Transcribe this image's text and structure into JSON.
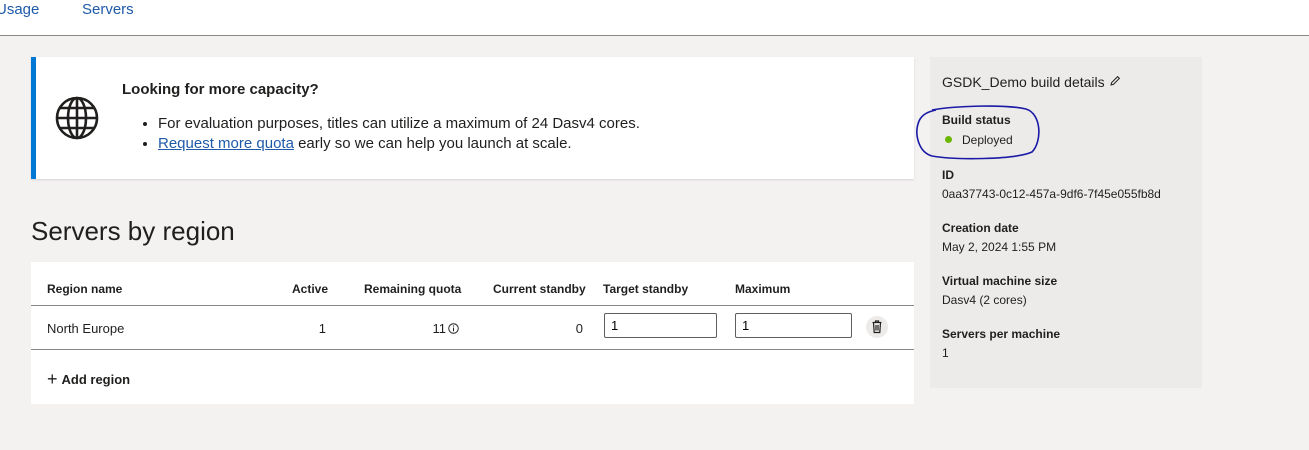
{
  "tabs": {
    "usage": "Usage",
    "servers": "Servers"
  },
  "banner": {
    "title": "Looking for more capacity?",
    "bullet1": "For evaluation purposes, titles can utilize a maximum of 24 Dasv4 cores.",
    "link": "Request more quota",
    "bullet2_rest": " early so we can help you launch at scale.",
    "icon": "globe-icon",
    "accent_color": "#0078d4"
  },
  "section": {
    "title": "Servers by region"
  },
  "table": {
    "headers": {
      "region": "Region name",
      "active": "Active",
      "remaining": "Remaining quota",
      "current_standby": "Current standby",
      "target_standby": "Target standby",
      "maximum": "Maximum"
    },
    "row": {
      "region": "North Europe",
      "active": "1",
      "remaining": "11",
      "current_standby": "0",
      "target_standby": "1",
      "maximum": "1"
    },
    "add_region": "Add region"
  },
  "details": {
    "title": "GSDK_Demo build details",
    "build_status_label": "Build status",
    "build_status_value": "Deployed",
    "status_color": "#6bb700",
    "id_label": "ID",
    "id_value": "0aa37743-0c12-457a-9df6-7f45e055fb8d",
    "creation_label": "Creation date",
    "creation_value": "May 2, 2024 1:55 PM",
    "vm_label": "Virtual machine size",
    "vm_value": "Dasv4 (2 cores)",
    "servers_label": "Servers per machine",
    "servers_value": "1"
  }
}
